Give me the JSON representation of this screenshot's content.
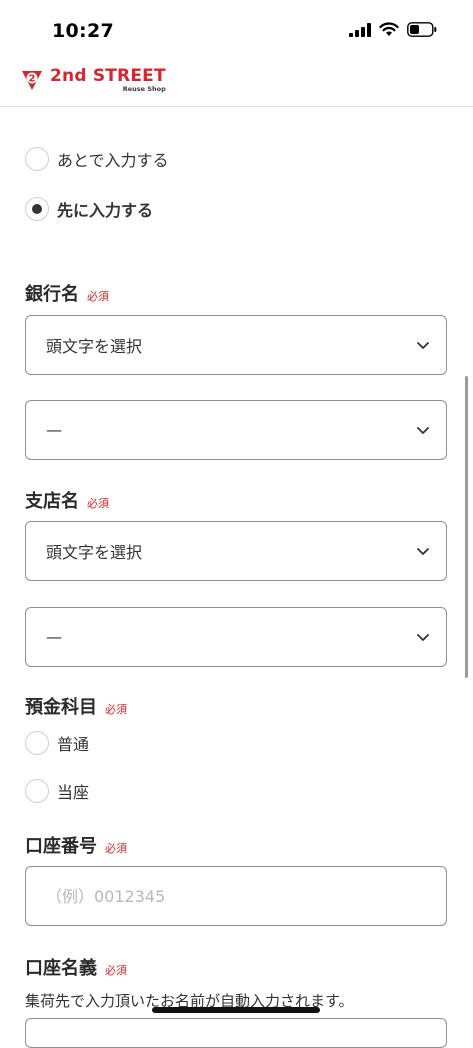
{
  "status_bar": {
    "time": "10:27"
  },
  "header": {
    "logo_main": "2nd STREET",
    "logo_sub": "Reuse Shop",
    "logo_badge": "2"
  },
  "input_timing": {
    "options": [
      {
        "label": "あとで入力する",
        "checked": false
      },
      {
        "label": "先に入力する",
        "checked": true
      }
    ]
  },
  "required_label": "必須",
  "bank": {
    "label": "銀行名",
    "initial_select": "頭文字を選択",
    "name_select": "—"
  },
  "branch": {
    "label": "支店名",
    "initial_select": "頭文字を選択",
    "name_select": "—"
  },
  "account_type": {
    "label": "預金科目",
    "options": [
      {
        "label": "普通",
        "checked": false
      },
      {
        "label": "当座",
        "checked": false
      }
    ]
  },
  "account_number": {
    "label": "口座番号",
    "placeholder": "（例）0012345"
  },
  "account_holder": {
    "label": "口座名義",
    "note": "集荷先で入力頂いたお名前が自動入力されます。"
  },
  "colors": {
    "brand": "#d6262b",
    "required": "#d6262b"
  }
}
